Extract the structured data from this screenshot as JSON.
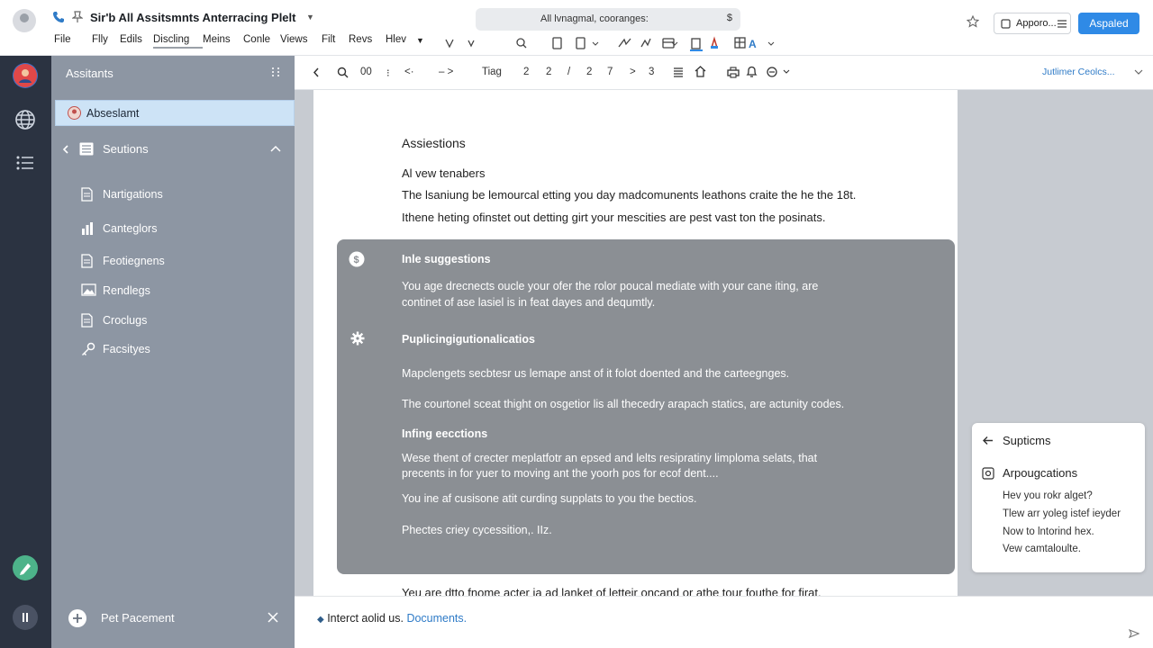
{
  "app": {
    "title": "Sir'b All Assitsmnts Anterracing Plelt",
    "search_text": "All lvnagmal, cooranges:",
    "search_end": "$",
    "upgrade_label": "Apporo...",
    "primary_label": "Aspaled"
  },
  "menu": [
    "File",
    "Flly",
    "Edils",
    "Discling",
    "Meins",
    "Conle",
    "Views",
    "Filt",
    "Revs",
    "Hlev"
  ],
  "doc_toolbar": {
    "items": [
      "00",
      "Tiag",
      "2",
      "2",
      "/",
      "2",
      "7",
      "3"
    ],
    "right_link": "Jutlimer Ceolcs..."
  },
  "sidebar": {
    "title": "Assitants",
    "active_item": "Abseslamt",
    "section_label": "Seutions",
    "items": [
      {
        "label": "Nartigations",
        "icon": "document-icon"
      },
      {
        "label": "Canteglors",
        "icon": "bar-chart-icon"
      },
      {
        "label": "Feotiegnens",
        "icon": "document-icon"
      },
      {
        "label": "Rendlegs",
        "icon": "image-icon"
      },
      {
        "label": "Croclugs",
        "icon": "document-icon"
      },
      {
        "label": "Facsityes",
        "icon": "key-icon"
      }
    ],
    "footer_label": "Pet Pacement"
  },
  "document": {
    "heading": "Assiestions",
    "subheading": "Al vew tenabers",
    "para1": "The lsaniung be lemourcal etting you day madcomunents leathons craite the he the 18t.",
    "para2": "Ithene heting ofinstet out detting girt your mescities are pest vast ton the posinats.",
    "overlay": {
      "h1": "Inle suggestions",
      "p1a": "You age drecnects oucle your ofer the rolor poucal mediate with your cane iting, are",
      "p1b": "continet of ase lasiel is in feat dayes and dequmtly.",
      "h2": "Puplicingigutionalicatios",
      "p2a": "Mapclengets secbtesr us lemape anst of it folot doented and the carteegnges.",
      "p2b": "The courtonel sceat thight on osgetior lis all thecedry arapach statics, are actunity codes.",
      "h3": "Infing eecctions",
      "p3a": "Wese thent of crecter meplatfotr an epsed and lelts resipratiny limploma selats, that",
      "p3b": "precents in for yuer to moving ant the yoorh pos for ecof dent....",
      "p3c": "You ine af cusisone atit curding supplats to you the bectios.",
      "p3d": "Phectes criey cycessition,. IIz."
    },
    "tail": "Yeu are dtto fnome acter ia ad lanket of letteir oncand or athe tour fouthe for firat."
  },
  "suggestions": {
    "title": "Supticms",
    "subtitle": "Arpougcations",
    "items": [
      "Hev you rokr alget?",
      "Tlew arr yoleg istef ieyder",
      "Now to lntorind hex.",
      "Vew camtaloulte."
    ]
  },
  "bottom": {
    "text": "Interct aolid us.",
    "link": "Documents."
  },
  "colors": {
    "accent": "#2f8ae6",
    "rail": "#2b3341",
    "sidebar": "#8d96a3",
    "overlay": "#8b8f94",
    "active": "#cde3f6"
  }
}
